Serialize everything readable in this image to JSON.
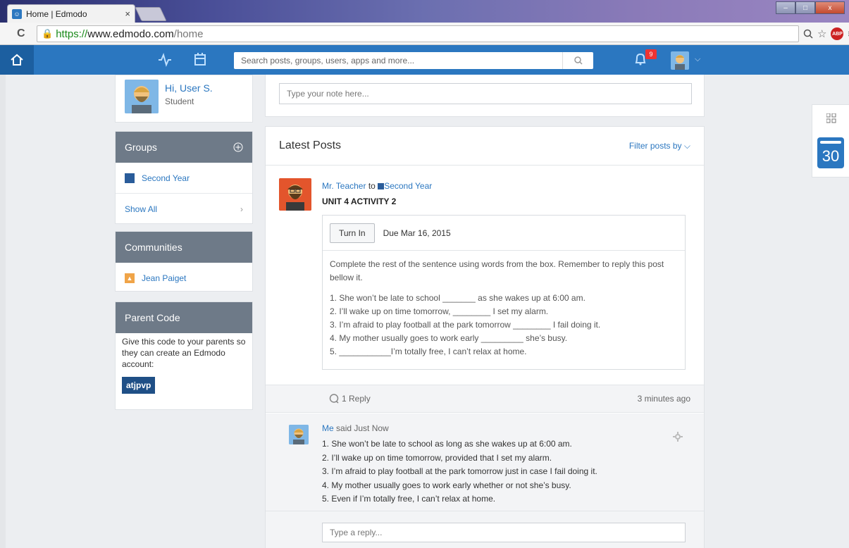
{
  "browser": {
    "tab_title": "Home | Edmodo",
    "tab_close": "×",
    "url_scheme": "https://",
    "url_host": "www.edmodo.com",
    "url_path": "/home",
    "abp_label": "ABP"
  },
  "nav": {
    "search_placeholder": "Search posts, groups, users, apps and more...",
    "notification_count": "9",
    "accent_color": "#2b77c0"
  },
  "profile": {
    "name": "Hi, User S.",
    "role": "Student"
  },
  "groups": {
    "header": "Groups",
    "items": [
      {
        "label": "Second Year"
      }
    ],
    "show_all": "Show All"
  },
  "communities": {
    "header": "Communities",
    "items": [
      {
        "label": "Jean Paiget"
      }
    ]
  },
  "parent_code": {
    "header": "Parent Code",
    "description": "Give this code to your parents so they can create an Edmodo account:",
    "code": "atjpvp"
  },
  "note": {
    "placeholder": "Type your note here..."
  },
  "posts": {
    "title": "Latest Posts",
    "filter_label": "Filter posts by",
    "post": {
      "author": "Mr. Teacher",
      "to_word": "to",
      "group": "Second Year",
      "title": "UNIT 4 ACTIVITY 2",
      "turn_in_label": "Turn In",
      "due": "Due Mar 16, 2015",
      "instructions": "Complete the rest of the sentence using words from the box. Remember to reply this post bellow it.",
      "lines": [
        "1. She won’t be late to school _______ as she wakes up at 6:00 am.",
        "2. I’ll wake up on time tomorrow, ________ I set my alarm.",
        "3. I’m afraid to play football at the park tomorrow ________ I fail doing it.",
        "4. My mother usually goes to work early _________ she’s busy.",
        "5. ___________I’m totally free, I can’t relax at home."
      ],
      "reply_count": "1 Reply",
      "time_ago": "3 minutes ago"
    },
    "reply": {
      "author": "Me",
      "said": "said Just Now",
      "lines": [
        "1. She won’t be late to school as long as she wakes up at 6:00 am.",
        "2. I’ll wake up on time tomorrow, provided that I set my alarm.",
        "3. I’m afraid to play football at the park tomorrow just in case I fail doing it.",
        "4. My mother usually goes to work early whether or not she’s busy.",
        "5. Even if I’m totally free, I can’t relax at home."
      ]
    },
    "reply_placeholder": "Type a reply..."
  },
  "widget": {
    "calendar_day": "30"
  }
}
